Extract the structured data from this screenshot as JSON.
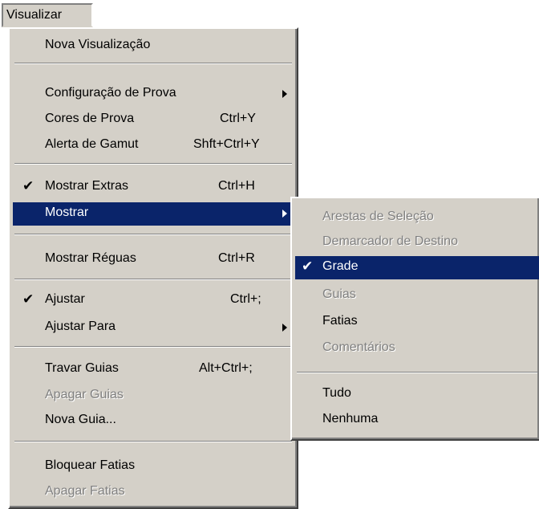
{
  "menubar": {
    "label": "Visualizar"
  },
  "main_menu": {
    "items": [
      {
        "label": "Nova Visualização",
        "shortcut": ""
      },
      {
        "label": "Configuração de Prova",
        "shortcut": ""
      },
      {
        "label": "Cores de Prova",
        "shortcut": "Ctrl+Y"
      },
      {
        "label": "Alerta de Gamut",
        "shortcut": "Shft+Ctrl+Y"
      },
      {
        "label": "Mostrar Extras",
        "shortcut": "Ctrl+H"
      },
      {
        "label": "Mostrar",
        "shortcut": ""
      },
      {
        "label": "Mostrar Réguas",
        "shortcut": "Ctrl+R"
      },
      {
        "label": "Ajustar",
        "shortcut": "Ctrl+;"
      },
      {
        "label": "Ajustar Para",
        "shortcut": ""
      },
      {
        "label": "Travar Guias",
        "shortcut": "Alt+Ctrl+;"
      },
      {
        "label": "Apagar Guias",
        "shortcut": ""
      },
      {
        "label": "Nova Guia...",
        "shortcut": ""
      },
      {
        "label": "Bloquear Fatias",
        "shortcut": ""
      },
      {
        "label": "Apagar Fatias",
        "shortcut": ""
      }
    ]
  },
  "sub_menu": {
    "items": [
      {
        "label": "Arestas de Seleção"
      },
      {
        "label": "Demarcador de Destino"
      },
      {
        "label": "Grade"
      },
      {
        "label": "Guias"
      },
      {
        "label": "Fatias"
      },
      {
        "label": "Comentários"
      },
      {
        "label": "Tudo"
      },
      {
        "label": "Nenhuma"
      }
    ]
  },
  "icons": {
    "check": "check-icon",
    "submenu_arrow": "submenu-arrow-icon"
  },
  "colors": {
    "menu_bg": "#d4d0c8",
    "highlight": "#0a246a",
    "disabled": "#808080"
  }
}
